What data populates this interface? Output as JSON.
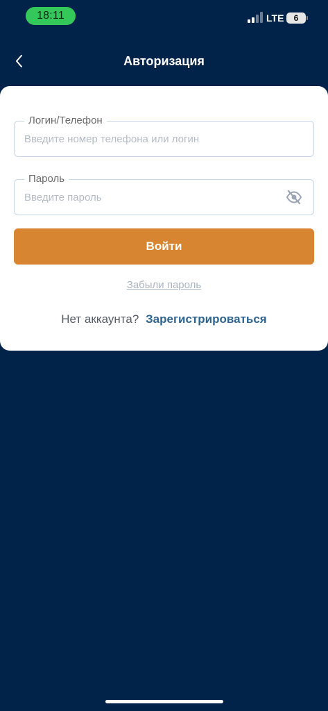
{
  "status_bar": {
    "time": "18:11",
    "network": "LTE",
    "battery": "6",
    "time_pill_color": "#34c759"
  },
  "header": {
    "back_icon": "chevron-left-icon",
    "title": "Авторизация"
  },
  "form": {
    "login": {
      "label": "Логин/Телефон",
      "placeholder": "Введите номер телефона или логин",
      "value": ""
    },
    "password": {
      "label": "Пароль",
      "placeholder": "Введите пароль",
      "value": "",
      "toggle_icon": "eye-off-icon"
    },
    "submit_label": "Войти",
    "forgot_label": "Забыли пароль",
    "no_account_text": "Нет аккаунта?",
    "register_label": "Зарегистрироваться"
  },
  "colors": {
    "background": "#012249",
    "card": "#ffffff",
    "primary_button": "#d88532",
    "link": "#2d6590"
  }
}
